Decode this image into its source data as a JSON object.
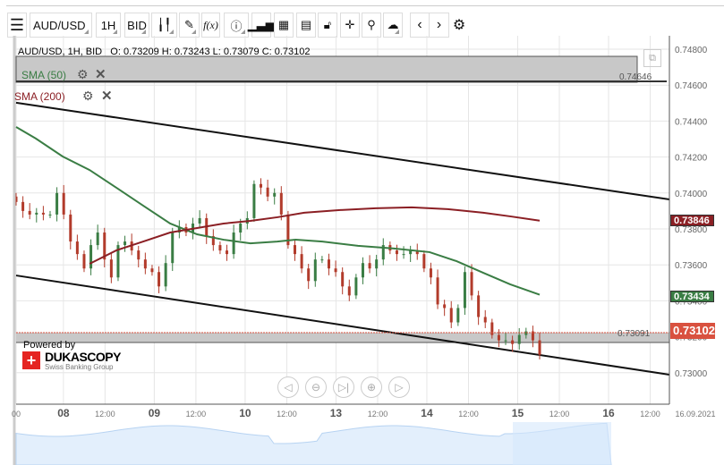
{
  "toolbar": {
    "menu_icon": "hamburger-icon",
    "symbol": "AUD/USD",
    "period": "1H",
    "side": "BID",
    "fx": "f(x)",
    "icons": [
      "candlestick-icon",
      "pencil-icon",
      "function-icon",
      "info-icon",
      "bar-chart-icon",
      "calendar-icon",
      "report-icon",
      "lock-icon",
      "crosshair-icon",
      "zoom-search-icon",
      "upload-cloud-icon",
      "chevron-left-icon",
      "chevron-right-icon",
      "gear-icon"
    ]
  },
  "legend": {
    "ohlc": "AUD/USD, 1H, BID   O: 0.73209 H: 0.73243 L: 0.73079 C: 0.73102",
    "sma50": "SMA (50)",
    "sma200": "SMA (200)"
  },
  "colors": {
    "sma50": "#3a7d44",
    "sma200": "#8b1f24",
    "up": "#3a7d44",
    "down": "#b23b2b",
    "last": "#d9513f"
  },
  "price_axis": [
    "0.74800",
    "0.74600",
    "0.74400",
    "0.74200",
    "0.74000",
    "0.73800",
    "0.73600",
    "0.73400",
    "0.73200",
    "0.73000"
  ],
  "badges": {
    "sma200": "0.73846",
    "sma50": "0.73434",
    "last": "0.73102"
  },
  "levels": {
    "upper_zone": "0.74646",
    "lower_zone": "0.73091"
  },
  "time_axis": [
    {
      "t": "00",
      "h": 0,
      "b": false
    },
    {
      "t": "08",
      "h": 12.5,
      "b": true
    },
    {
      "t": "12:00",
      "h": 23.5,
      "b": false
    },
    {
      "t": "09",
      "h": 36.5,
      "b": true
    },
    {
      "t": "12:00",
      "h": 47.5,
      "b": false
    },
    {
      "t": "10",
      "h": 60.5,
      "b": true
    },
    {
      "t": "12:00",
      "h": 71.5,
      "b": false
    },
    {
      "t": "13",
      "h": 84.5,
      "b": true
    },
    {
      "t": "12:00",
      "h": 95.5,
      "b": false
    },
    {
      "t": "14",
      "h": 108.5,
      "b": true
    },
    {
      "t": "12:00",
      "h": 119.5,
      "b": false
    },
    {
      "t": "15",
      "h": 132.5,
      "b": true
    },
    {
      "t": "12:00",
      "h": 143.5,
      "b": false
    },
    {
      "t": "16",
      "h": 156.5,
      "b": true
    },
    {
      "t": "12:00",
      "h": 167.5,
      "b": false
    }
  ],
  "date_label": "16.09.2021",
  "branding": {
    "powered": "Powered by",
    "name": "DUKASCOPY",
    "sub": "Swiss Banking Group"
  },
  "nav_buttons": [
    "scroll-left",
    "zoom-out",
    "go-latest",
    "zoom-in",
    "scroll-right"
  ],
  "chart_data": {
    "closes": [
      0.7395,
      0.739,
      0.7388,
      0.7389,
      0.7388,
      0.7388,
      0.74,
      0.7388,
      0.7373,
      0.7366,
      0.7358,
      0.7371,
      0.7378,
      0.7363,
      0.7353,
      0.7371,
      0.7373,
      0.7368,
      0.7363,
      0.7358,
      0.7356,
      0.7348,
      0.7361,
      0.7378,
      0.7381,
      0.7378,
      0.7383,
      0.7386,
      0.7376,
      0.7371,
      0.7368,
      0.7366,
      0.7378,
      0.7383,
      0.7386,
      0.7405,
      0.7403,
      0.7398,
      0.74,
      0.7388,
      0.7371,
      0.7366,
      0.7358,
      0.7351,
      0.7363,
      0.7363,
      0.7358,
      0.7356,
      0.7348,
      0.7343,
      0.7353,
      0.7361,
      0.7358,
      0.7363,
      0.7371,
      0.7368,
      0.7366,
      0.7366,
      0.7368,
      0.7366,
      0.7358,
      0.7353,
      0.7338,
      0.7336,
      0.7328,
      0.7336,
      0.7356,
      0.7343,
      0.7331,
      0.7328,
      0.7321,
      0.7318,
      0.7318,
      0.7316,
      0.7321,
      0.7323,
      0.7318,
      0.731
    ],
    "sma50": [
      [
        0,
        0.74367
      ],
      [
        5.2,
        0.74303
      ],
      [
        12.3,
        0.74203
      ],
      [
        19.4,
        0.74128
      ],
      [
        26.5,
        0.74029
      ],
      [
        33.6,
        0.73929
      ],
      [
        40.7,
        0.7383
      ],
      [
        47.8,
        0.7377
      ],
      [
        54.8,
        0.7374
      ],
      [
        61.9,
        0.7372
      ],
      [
        69,
        0.7373
      ],
      [
        73.8,
        0.7374
      ],
      [
        80.9,
        0.7373
      ],
      [
        90.3,
        0.73706
      ],
      [
        99.8,
        0.73691
      ],
      [
        109.2,
        0.73671
      ],
      [
        116.3,
        0.73621
      ],
      [
        123.4,
        0.73556
      ],
      [
        130.5,
        0.73492
      ],
      [
        138.3,
        0.73434
      ]
    ],
    "sma200": [
      [
        19.4,
        0.73606
      ],
      [
        26.5,
        0.73681
      ],
      [
        33.6,
        0.7373
      ],
      [
        40.7,
        0.7378
      ],
      [
        47.8,
        0.73805
      ],
      [
        54.8,
        0.7383
      ],
      [
        61.9,
        0.73845
      ],
      [
        69,
        0.73865
      ],
      [
        76.1,
        0.7389
      ],
      [
        85.6,
        0.73905
      ],
      [
        95,
        0.73915
      ],
      [
        104.5,
        0.7392
      ],
      [
        114,
        0.7391
      ],
      [
        123.4,
        0.7389
      ],
      [
        130.5,
        0.7387
      ],
      [
        138.3,
        0.73846
      ]
    ],
    "trend_upper": [
      [
        0,
        0.74502
      ],
      [
        172.6,
        0.73964
      ]
    ],
    "trend_lower": [
      [
        0,
        0.73541
      ],
      [
        172.6,
        0.72989
      ]
    ],
    "ylim": [
      0.729,
      0.749
    ],
    "last_hour": 138.3
  }
}
